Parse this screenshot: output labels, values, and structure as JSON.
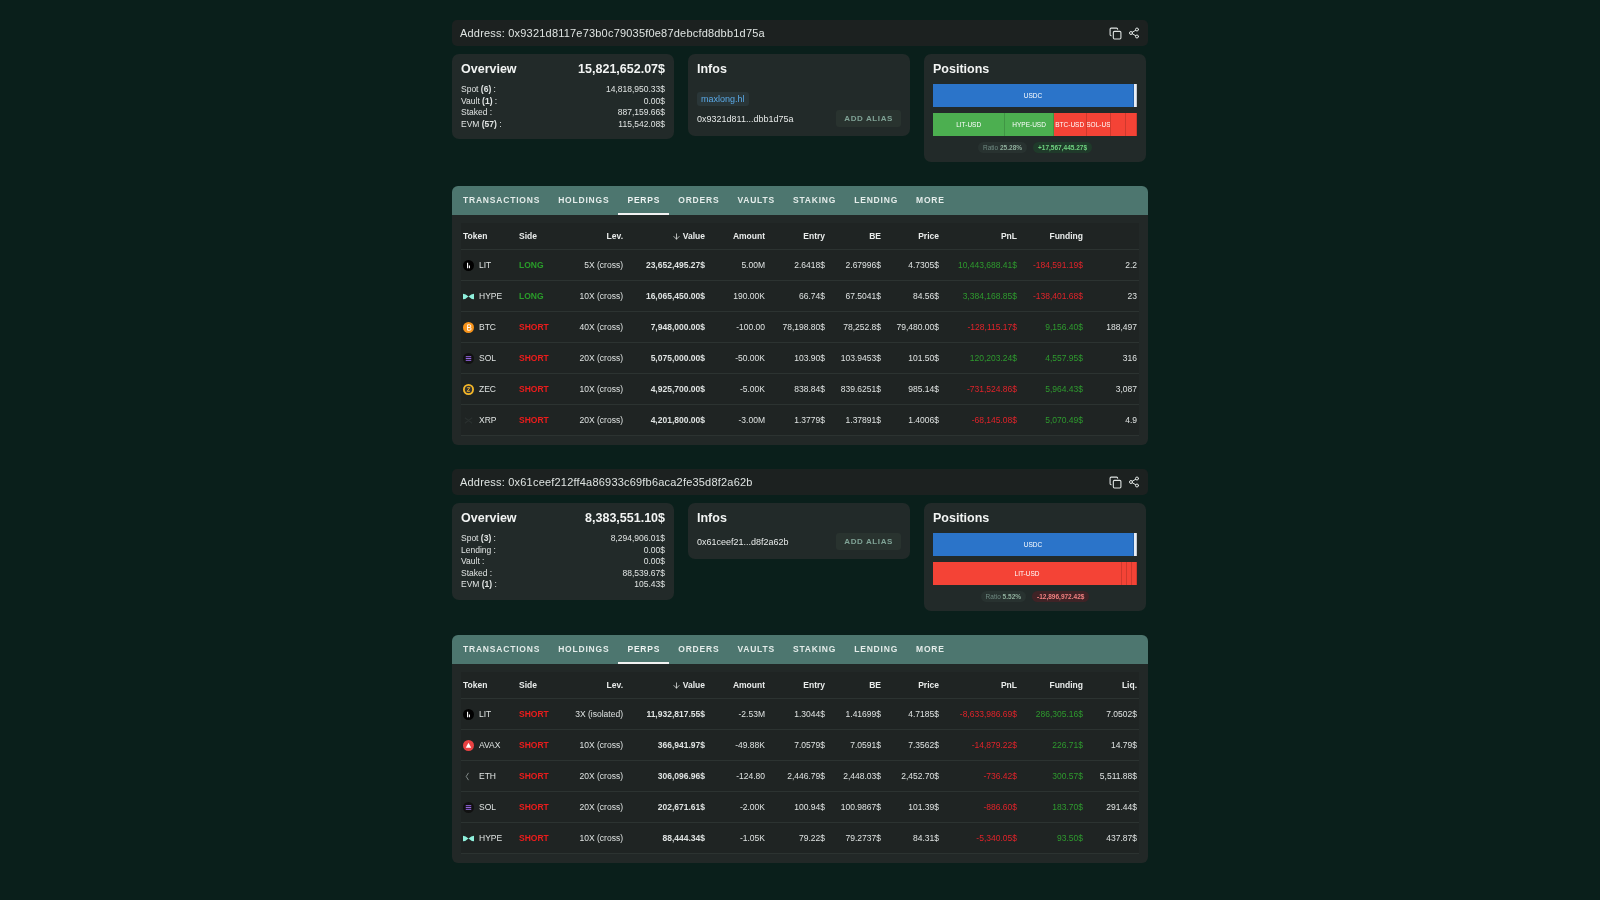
{
  "wallets": [
    {
      "address_label": "Address:",
      "address": "0x9321d8117e73b0c79035f0e87debcfd8dbb1d75a",
      "overview": {
        "title": "Overview",
        "total": "15,821,652.07$",
        "rows": [
          {
            "label": "Spot **(6)** :",
            "value": "14,818,950.33$"
          },
          {
            "label": "Vault **(1)** :",
            "value": "0.00$"
          },
          {
            "label": "Staked :",
            "value": "887,159.66$"
          },
          {
            "label": "EVM **(57)** :",
            "value": "115,542.08$"
          }
        ]
      },
      "infos": {
        "title": "Infos",
        "alias": "maxlong.hl",
        "short_address": "0x9321d811...dbb1d75a",
        "button": "ADD ALIAS"
      },
      "positions": {
        "title": "Positions",
        "bars": [
          {
            "segments": [
              {
                "label": "USDC",
                "color": "#2b74c9"
              },
              {
                "color": "#e8eef5"
              }
            ]
          },
          {
            "segments": [
              {
                "label": "LIT-USD",
                "color": "#4caf50"
              },
              {
                "label": "HYPE-USD",
                "color": "#4caf50"
              },
              {
                "label": "BTC-USD",
                "color": "#f44336"
              },
              {
                "label": "SOL-US",
                "color": "#f44336"
              },
              {
                "color": "#f44336"
              },
              {
                "color": "#f44336"
              }
            ]
          }
        ],
        "ratio_label": "Ratio",
        "ratio": "25.28%",
        "pnl": {
          "text": "+17,567,445.27$",
          "kind": "gain"
        }
      },
      "tabs": [
        {
          "label": "TRANSACTIONS",
          "selected": false
        },
        {
          "label": "HOLDINGS",
          "selected": false
        },
        {
          "label": "PERPS",
          "selected": true
        },
        {
          "label": "ORDERS",
          "selected": false
        },
        {
          "label": "VAULTS",
          "selected": false
        },
        {
          "label": "STAKING",
          "selected": false
        },
        {
          "label": "LENDING",
          "selected": false
        },
        {
          "label": "MORE",
          "selected": false
        }
      ],
      "columns": [
        "Token",
        "Side",
        "Lev.",
        "Value",
        "Amount",
        "Entry",
        "BE",
        "Price",
        "PnL",
        "Funding"
      ],
      "rows": [
        {
          "kind": "lit",
          "token": "LIT",
          "side": {
            "text": "LONG",
            "kind": "long"
          },
          "lev": "5X (cross)",
          "value": "23,652,495.27$",
          "amount": "5.00M",
          "entry": "2.6418$",
          "be": "2.67996$",
          "price": "4.7305$",
          "pnl": {
            "text": "10,443,688.41$",
            "kind": "gain"
          },
          "funding": {
            "text": "-184,591.19$",
            "kind": "loss"
          },
          "liq": "2.2"
        },
        {
          "kind": "hype",
          "token": "HYPE",
          "side": {
            "text": "LONG",
            "kind": "long"
          },
          "lev": "10X (cross)",
          "value": "16,065,450.00$",
          "amount": "190.00K",
          "entry": "66.74$",
          "be": "67.5041$",
          "price": "84.56$",
          "pnl": {
            "text": "3,384,168.85$",
            "kind": "gain"
          },
          "funding": {
            "text": "-138,401.68$",
            "kind": "loss"
          },
          "liq": "23"
        },
        {
          "kind": "btc",
          "token": "BTC",
          "side": {
            "text": "SHORT",
            "kind": "short"
          },
          "lev": "40X (cross)",
          "value": "7,948,000.00$",
          "amount": "-100.00",
          "entry": "78,198.80$",
          "be": "78,252.8$",
          "price": "79,480.00$",
          "pnl": {
            "text": "-128,115.17$",
            "kind": "loss"
          },
          "funding": {
            "text": "9,156.40$",
            "kind": "gain"
          },
          "liq": "188,497"
        },
        {
          "kind": "sol",
          "token": "SOL",
          "side": {
            "text": "SHORT",
            "kind": "short"
          },
          "lev": "20X (cross)",
          "value": "5,075,000.00$",
          "amount": "-50.00K",
          "entry": "103.90$",
          "be": "103.9453$",
          "price": "101.50$",
          "pnl": {
            "text": "120,203.24$",
            "kind": "gain"
          },
          "funding": {
            "text": "4,557.95$",
            "kind": "gain"
          },
          "liq": "316"
        },
        {
          "kind": "zec",
          "token": "ZEC",
          "side": {
            "text": "SHORT",
            "kind": "short"
          },
          "lev": "10X (cross)",
          "value": "4,925,700.00$",
          "amount": "-5.00K",
          "entry": "838.84$",
          "be": "839.6251$",
          "price": "985.14$",
          "pnl": {
            "text": "-731,524.86$",
            "kind": "loss"
          },
          "funding": {
            "text": "5,964.43$",
            "kind": "gain"
          },
          "liq": "3,087"
        },
        {
          "kind": "xrp",
          "token": "XRP",
          "side": {
            "text": "SHORT",
            "kind": "short"
          },
          "lev": "20X (cross)",
          "value": "4,201,800.00$",
          "amount": "-3.00M",
          "entry": "1.3779$",
          "be": "1.37891$",
          "price": "1.4006$",
          "pnl": {
            "text": "-68,145.08$",
            "kind": "loss"
          },
          "funding": {
            "text": "5,070.49$",
            "kind": "gain"
          },
          "liq": "4.9"
        }
      ]
    },
    {
      "address_label": "Address:",
      "address": "0x61ceef212ff4a86933c69fb6aca2fe35d8f2a62b",
      "overview": {
        "title": "Overview",
        "total": "8,383,551.10$",
        "rows": [
          {
            "label": "Spot **(3)** :",
            "value": "8,294,906.01$"
          },
          {
            "label": "Lending :",
            "value": "0.00$"
          },
          {
            "label": "Vault :",
            "value": "0.00$"
          },
          {
            "label": "Staked :",
            "value": "88,539.67$"
          },
          {
            "label": "EVM **(1)** :",
            "value": "105.43$"
          }
        ]
      },
      "infos": {
        "title": "Infos",
        "short_address": "0x61ceef21...d8f2a62b",
        "button": "ADD ALIAS"
      },
      "positions": {
        "title": "Positions",
        "bars": [
          {
            "segments": [
              {
                "label": "USDC",
                "color": "#2b74c9"
              },
              {
                "color": "#e8eef5"
              }
            ]
          },
          {
            "segments": [
              {
                "label": "LIT-USD",
                "color": "#f44336"
              },
              {
                "color": "#f44336"
              },
              {
                "color": "#f44336"
              },
              {
                "color": "#f44336"
              }
            ]
          }
        ],
        "ratio_label": "Ratio",
        "ratio": "5.52%",
        "pnl": {
          "text": "-12,896,972.42$",
          "kind": "loss"
        }
      },
      "tabs": [
        {
          "label": "TRANSACTIONS",
          "selected": false
        },
        {
          "label": "HOLDINGS",
          "selected": false
        },
        {
          "label": "PERPS",
          "selected": true
        },
        {
          "label": "ORDERS",
          "selected": false
        },
        {
          "label": "VAULTS",
          "selected": false
        },
        {
          "label": "STAKING",
          "selected": false
        },
        {
          "label": "LENDING",
          "selected": false
        },
        {
          "label": "MORE",
          "selected": false
        }
      ],
      "columns": [
        "Token",
        "Side",
        "Lev.",
        "Value",
        "Amount",
        "Entry",
        "BE",
        "Price",
        "PnL",
        "Funding",
        "Liq."
      ],
      "rows": [
        {
          "kind": "lit",
          "token": "LIT",
          "side": {
            "text": "SHORT",
            "kind": "short"
          },
          "lev": "3X (isolated)",
          "value": "11,932,817.55$",
          "amount": "-2.53M",
          "entry": "1.3044$",
          "be": "1.41699$",
          "price": "4.7185$",
          "pnl": {
            "text": "-8,633,986.69$",
            "kind": "loss"
          },
          "funding": {
            "text": "286,305.16$",
            "kind": "gain"
          },
          "liq": "7.0502$"
        },
        {
          "kind": "avax",
          "token": "AVAX",
          "side": {
            "text": "SHORT",
            "kind": "short"
          },
          "lev": "10X (cross)",
          "value": "366,941.97$",
          "amount": "-49.88K",
          "entry": "7.0579$",
          "be": "7.0591$",
          "price": "7.3562$",
          "pnl": {
            "text": "-14,879.22$",
            "kind": "loss"
          },
          "funding": {
            "text": "226.71$",
            "kind": "gain"
          },
          "liq": "14.79$"
        },
        {
          "kind": "eth",
          "token": "ETH",
          "side": {
            "text": "SHORT",
            "kind": "short"
          },
          "lev": "20X (cross)",
          "value": "306,096.96$",
          "amount": "-124.80",
          "entry": "2,446.79$",
          "be": "2,448.03$",
          "price": "2,452.70$",
          "pnl": {
            "text": "-736.42$",
            "kind": "loss"
          },
          "funding": {
            "text": "300.57$",
            "kind": "gain"
          },
          "liq": "5,511.88$"
        },
        {
          "kind": "sol",
          "token": "SOL",
          "side": {
            "text": "SHORT",
            "kind": "short"
          },
          "lev": "20X (cross)",
          "value": "202,671.61$",
          "amount": "-2.00K",
          "entry": "100.94$",
          "be": "100.9867$",
          "price": "101.39$",
          "pnl": {
            "text": "-886.60$",
            "kind": "loss"
          },
          "funding": {
            "text": "183.70$",
            "kind": "gain"
          },
          "liq": "291.44$"
        },
        {
          "kind": "hype",
          "token": "HYPE",
          "side": {
            "text": "SHORT",
            "kind": "short"
          },
          "lev": "10X (cross)",
          "value": "88,444.34$",
          "amount": "-1.05K",
          "entry": "79.22$",
          "be": "79.2737$",
          "price": "84.31$",
          "pnl": {
            "text": "-5,340.05$",
            "kind": "loss"
          },
          "funding": {
            "text": "93.50$",
            "kind": "gain"
          },
          "liq": "437.87$"
        }
      ]
    }
  ]
}
